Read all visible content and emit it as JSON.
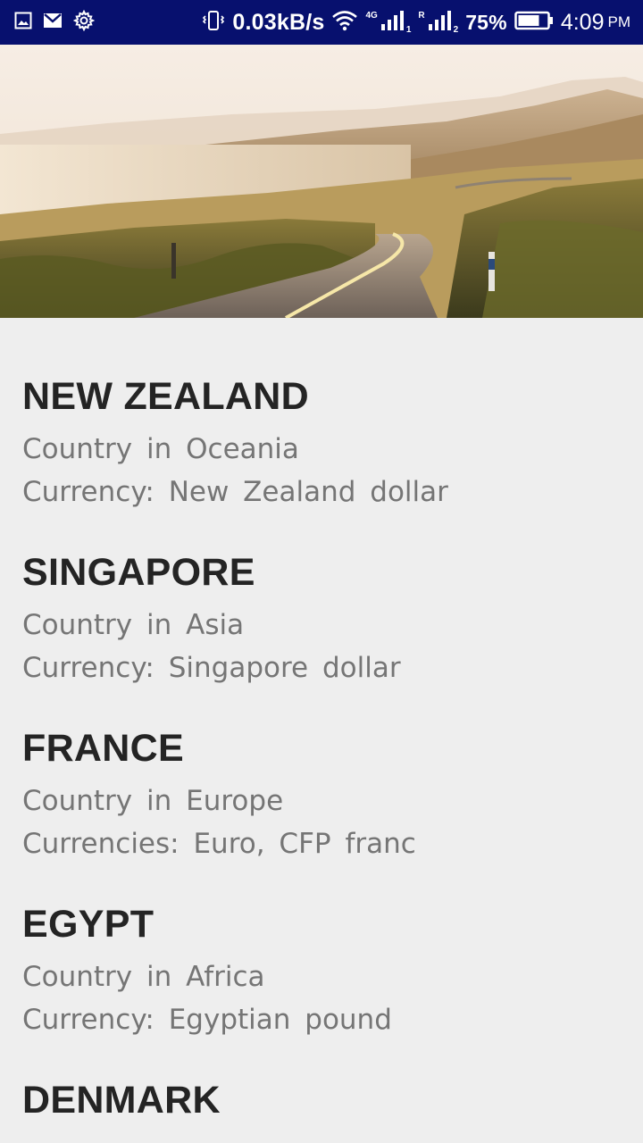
{
  "status_bar": {
    "net_speed": "0.03kB/s",
    "net_type": "4G",
    "sim1_label": "1",
    "sim2_label": "2",
    "sim2_roaming": "R",
    "battery_percent": "75%",
    "battery_level": 0.75,
    "time": "4:09",
    "ampm": "PM",
    "icons": [
      "gallery-icon",
      "gmail-icon",
      "settings-gear-icon",
      "vibrate-icon",
      "wifi-icon",
      "signal-icon",
      "signal-icon",
      "battery-icon"
    ]
  },
  "hero": {
    "description_icon": "coastal-road-landscape-image"
  },
  "countries": [
    {
      "name": "NEW ZEALAND",
      "line1": "Country in Oceania",
      "line2": "Currency: New Zealand dollar"
    },
    {
      "name": "SINGAPORE",
      "line1": "Country in Asia",
      "line2": "Currency: Singapore dollar"
    },
    {
      "name": "FRANCE",
      "line1": "Country in Europe",
      "line2": "Currencies: Euro, CFP franc"
    },
    {
      "name": "EGYPT",
      "line1": "Country in Africa",
      "line2": "Currency: Egyptian pound"
    },
    {
      "name": "DENMARK",
      "line1": "",
      "line2": ""
    }
  ],
  "colors": {
    "status_bar_bg": "#07106e",
    "page_bg": "#eeeeee",
    "title_text": "#242424",
    "body_text": "#757575"
  }
}
